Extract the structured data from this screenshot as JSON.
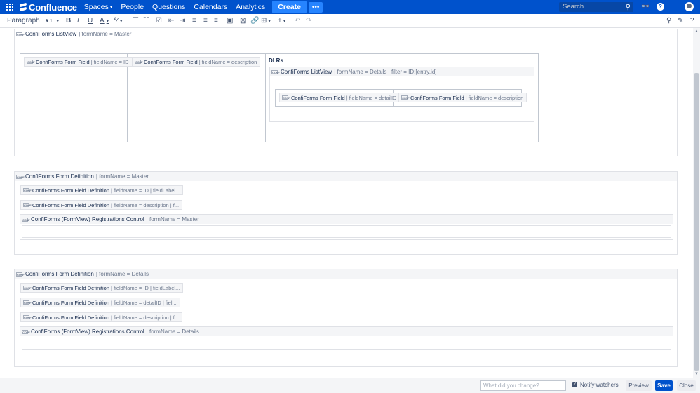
{
  "nav": {
    "app_name": "Confluence",
    "items": [
      {
        "label": "Spaces",
        "caret": "▾"
      },
      {
        "label": "People"
      },
      {
        "label": "Questions"
      },
      {
        "label": "Calendars"
      },
      {
        "label": "Analytics"
      }
    ],
    "create_label": "Create",
    "more_label": "•••",
    "search_placeholder": "Search",
    "brand_color": "#0052cc"
  },
  "toolbar": {
    "paragraph_label": "Paragraph",
    "line_spacing_label": "1.1",
    "bold": "B",
    "italic": "I",
    "underline": "U",
    "text_color": "A"
  },
  "icon_label": "CONF",
  "content": {
    "listview_master": {
      "title": "ConfiForms ListView",
      "params": "| formName = Master",
      "col1_field": {
        "title": "ConfiForms Form Field",
        "params": "| fieldName = ID"
      },
      "col2_field": {
        "title": "ConfiForms Form Field",
        "params": "| fieldName = description"
      },
      "col3_heading": "DLRs",
      "nested_listview": {
        "title": "ConfiForms ListView",
        "params": "| formName = Details | filter = ID:[entry.id]",
        "field1": {
          "title": "ConfiForms Form Field",
          "params": "| fieldName = detailID"
        },
        "field2": {
          "title": "ConfiForms Form Field",
          "params": "| fieldName = description"
        }
      }
    },
    "definition_master": {
      "title": "ConfiForms Form Definition",
      "params": "| formName = Master",
      "fields": [
        {
          "title": "ConfiForms Form Field Definition",
          "params": "| fieldName = ID | fieldLabel..."
        },
        {
          "title": "ConfiForms Form Field Definition",
          "params": "| fieldName = description | f..."
        }
      ],
      "registration": {
        "title": "ConfiForms (FormView) Registrations Control",
        "params": "| formName = Master"
      }
    },
    "definition_details": {
      "title": "ConfiForms Form Definition",
      "params": "| formName = Details",
      "fields": [
        {
          "title": "ConfiForms Form Field Definition",
          "params": "| fieldName = ID | fieldLabel..."
        },
        {
          "title": "ConfiForms Form Field Definition",
          "params": "| fieldName = detailID | fiel..."
        },
        {
          "title": "ConfiForms Form Field Definition",
          "params": "| fieldName = description | f..."
        }
      ],
      "registration": {
        "title": "ConfiForms (FormView) Registrations Control",
        "params": "| formName = Details"
      }
    }
  },
  "footer": {
    "change_placeholder": "What did you change?",
    "notify_label": "Notify watchers",
    "notify_checked": true,
    "preview_label": "Preview",
    "save_label": "Save",
    "close_label": "Close"
  }
}
